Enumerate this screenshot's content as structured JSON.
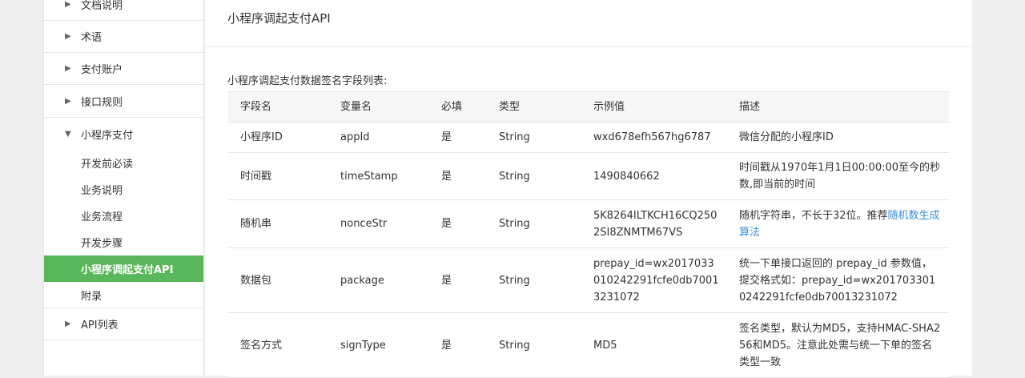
{
  "sidebar": {
    "items": [
      {
        "label": "文档说明"
      },
      {
        "label": "术语"
      },
      {
        "label": "支付账户"
      },
      {
        "label": "接口规则"
      },
      {
        "label": "小程序支付"
      },
      {
        "label": "开发前必读"
      },
      {
        "label": "业务说明"
      },
      {
        "label": "业务流程"
      },
      {
        "label": "开发步骤"
      },
      {
        "label": "小程序调起支付API"
      },
      {
        "label": "附录"
      },
      {
        "label": "API列表"
      }
    ],
    "active_color": "#5bb75b"
  },
  "page": {
    "title": "小程序调起支付API",
    "table_caption": "小程序调起支付数据签名字段列表:"
  },
  "table": {
    "headers": [
      "字段名",
      "变量名",
      "必填",
      "类型",
      "示例值",
      "描述"
    ],
    "rows": [
      {
        "field": "小程序ID",
        "var": "appId",
        "required": "是",
        "type": "String",
        "example": "wxd678efh567hg6787",
        "desc": "微信分配的小程序ID"
      },
      {
        "field": "时间戳",
        "var": "timeStamp",
        "required": "是",
        "type": "String",
        "example": "1490840662",
        "desc": "时间戳从1970年1月1日00:00:00至今的秒数,即当前的时间"
      },
      {
        "field": "随机串",
        "var": "nonceStr",
        "required": "是",
        "type": "String",
        "example": "5K8264ILTKCH16CQ2502SI8ZNMTM67VS",
        "desc": "随机字符串，不长于32位。推荐",
        "desc_link": "随机数生成算法"
      },
      {
        "field": "数据包",
        "var": "package",
        "required": "是",
        "type": "String",
        "example": "prepay_id=wx2017033010242291fcfe0db70013231072",
        "desc": "统一下单接口返回的 prepay_id 参数值，提交格式如：prepay_id=wx2017033010242291fcfe0db70013231072"
      },
      {
        "field": "签名方式",
        "var": "signType",
        "required": "是",
        "type": "String",
        "example": "MD5",
        "desc": "签名类型，默认为MD5，支持HMAC-SHA256和MD5。注意此处需与统一下单的签名类型一致"
      }
    ]
  }
}
